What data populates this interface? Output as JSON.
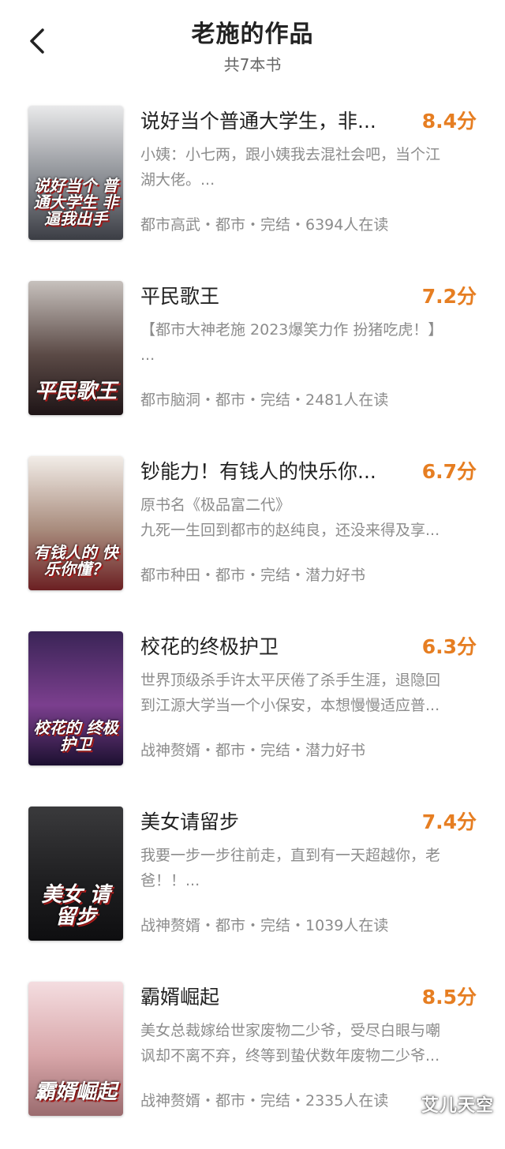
{
  "header": {
    "title": "老施的作品",
    "subtitle": "共7本书"
  },
  "books": [
    {
      "title": "说好当个普通大学生，非...",
      "rating": "8.4分",
      "desc": [
        "小姨：小七两，跟小姨我去混社会吧，当个江",
        "湖大佬。..."
      ],
      "meta": "都市高武・都市・完结・6394人在读",
      "cover_text": "说好当个 普通大学生 非逼我出手",
      "cover_colors": [
        "#e9e9ea",
        "#8a8d93",
        "#3b3d44"
      ]
    },
    {
      "title": "平民歌王",
      "rating": "7.2分",
      "desc": [
        "【都市大神老施 2023爆笑力作 扮猪吃虎！】",
        "..."
      ],
      "meta": "都市脑洞・都市・完结・2481人在读",
      "cover_text": "平民歌王",
      "cover_colors": [
        "#c7c1bd",
        "#5b4a46",
        "#1e1416"
      ]
    },
    {
      "title": "钞能力！有钱人的快乐你...",
      "rating": "6.7分",
      "desc": [
        "原书名《极品富二代》",
        "九死一生回到都市的赵纯良，还没来得及享..."
      ],
      "meta": "都市种田・都市・完结・潜力好书",
      "cover_text": "有钱人的 快乐你懂？",
      "cover_colors": [
        "#f2ede8",
        "#a88b7c",
        "#6b1f22"
      ]
    },
    {
      "title": "校花的终极护卫",
      "rating": "6.3分",
      "desc": [
        "世界顶级杀手许太平厌倦了杀手生涯，退隐回",
        "到江源大学当一个小保安，本想慢慢适应普..."
      ],
      "meta": "战神赘婿・都市・完结・潜力好书",
      "cover_text": "校花的 终极护卫",
      "cover_colors": [
        "#3a2456",
        "#7b3f8e",
        "#1c1030"
      ]
    },
    {
      "title": "美女请留步",
      "rating": "7.4分",
      "desc": [
        "我要一步一步往前走，直到有一天超越你，老",
        "爸！！..."
      ],
      "meta": "战神赘婿・都市・完结・1039人在读",
      "cover_text": "美女 请留步",
      "cover_colors": [
        "#3a3a3c",
        "#1f1f21",
        "#0e0e10"
      ]
    },
    {
      "title": "霸婿崛起",
      "rating": "8.5分",
      "desc": [
        "美女总裁嫁给世家废物二少爷，受尽白眼与嘲",
        "讽却不离不弃，终等到蛰伏数年废物二少爷..."
      ],
      "meta": "战神赘婿・都市・完结・2335人在读",
      "cover_text": "霸婿崛起",
      "cover_colors": [
        "#f4dde0",
        "#d8a6a9",
        "#9a6b6e"
      ]
    }
  ],
  "watermark": "艾儿天空",
  "colors": {
    "accent": "#e67e22",
    "secondary_text": "#8c8c8c"
  },
  "icons": {
    "back": "chevron-left-icon"
  }
}
